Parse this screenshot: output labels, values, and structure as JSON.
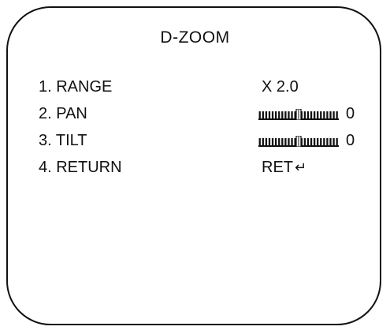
{
  "menu": {
    "title": "D-ZOOM",
    "items": [
      {
        "label": "1. RANGE",
        "value": "X  2.0"
      },
      {
        "label": "2. PAN",
        "value": "0",
        "slider_level": 0.5
      },
      {
        "label": "3. TILT",
        "value": "0",
        "slider_level": 0.5
      },
      {
        "label": "4. RETURN",
        "value": "RET",
        "value_symbol": "↵"
      }
    ]
  },
  "icons": {
    "return_symbol": "return-arrow-icon"
  },
  "colors": {
    "foreground": "#111111",
    "background": "#ffffff"
  }
}
